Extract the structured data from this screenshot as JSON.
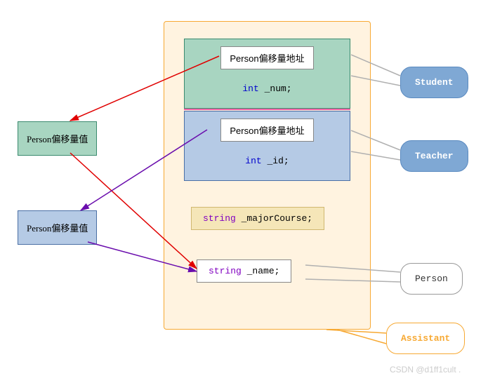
{
  "container": {
    "student": {
      "ptr_label": "Person偏移量地址",
      "field": {
        "type": "int",
        "name": "_num;"
      }
    },
    "teacher": {
      "ptr_label": "Person偏移量地址",
      "field": {
        "type": "int",
        "name": "_id;"
      }
    },
    "major_course": {
      "type": "string",
      "name": "_majorCourse",
      "semi": ";"
    },
    "person_field": {
      "type": "string",
      "name": "_name;"
    }
  },
  "offsets": {
    "green": "Person偏移量值",
    "blue": "Person偏移量值"
  },
  "callouts": {
    "student": "Student",
    "teacher": "Teacher",
    "person": "Person",
    "assistant": "Assistant"
  },
  "watermark": "CSDN @d1ff1cult ."
}
